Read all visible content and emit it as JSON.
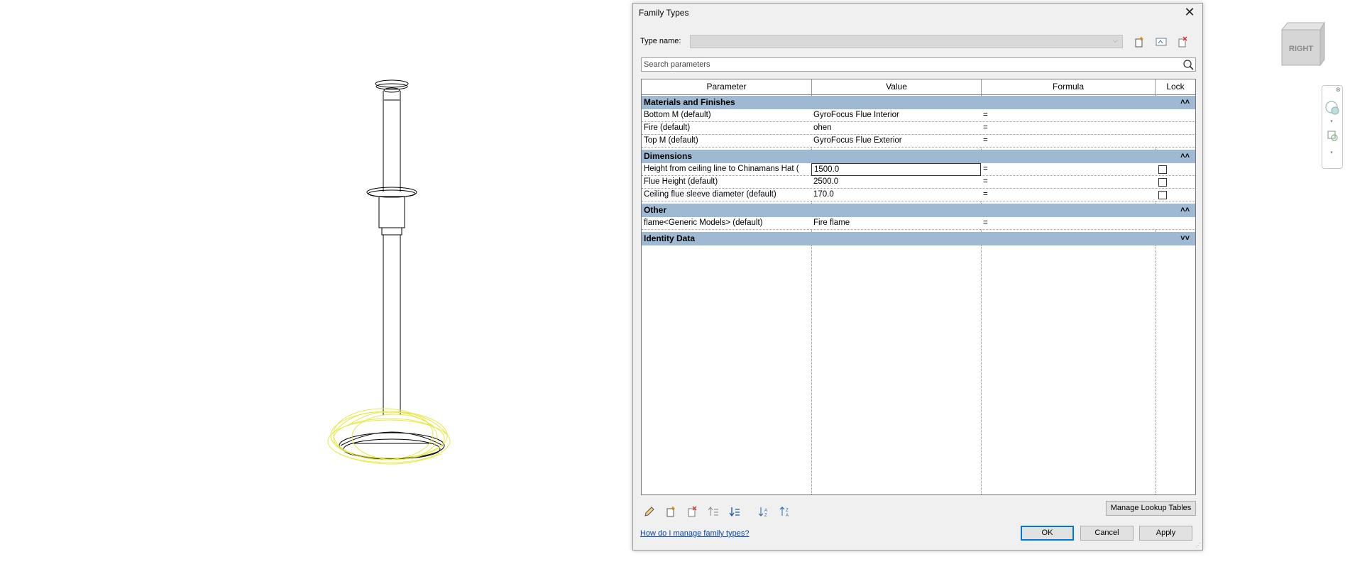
{
  "viewcube": {
    "face_label": "RIGHT"
  },
  "dialog": {
    "title": "Family Types",
    "close_glyph": "✕",
    "type_name_label": "Type name:",
    "type_name_value": "",
    "search_placeholder": "Search parameters",
    "columns": [
      "Parameter",
      "Value",
      "Formula",
      "Lock"
    ],
    "groups": [
      {
        "name": "Materials and Finishes",
        "toggle": "˄˄",
        "rows": [
          {
            "parameter": "Bottom M (default)",
            "value": "GyroFocus Flue Interior",
            "formula": "=",
            "lock": null
          },
          {
            "parameter": "Fire (default)",
            "value": "ohen",
            "formula": "=",
            "lock": null
          },
          {
            "parameter": "Top M (default)",
            "value": "GyroFocus Flue Exterior",
            "formula": "=",
            "lock": null
          }
        ]
      },
      {
        "name": "Dimensions",
        "toggle": "˄˄",
        "rows": [
          {
            "parameter": "Height from ceiling line to Chinamans Hat (",
            "value": "1500.0",
            "formula": "=",
            "lock": false
          },
          {
            "parameter": "Flue Height (default)",
            "value": "2500.0",
            "formula": "=",
            "lock": false
          },
          {
            "parameter": "Ceiling flue sleeve diameter (default)",
            "value": "170.0",
            "formula": "=",
            "lock": false
          }
        ]
      },
      {
        "name": "Other",
        "toggle": "˄˄",
        "rows": [
          {
            "parameter": "flame<Generic Models> (default)",
            "value": "Fire flame",
            "formula": "=",
            "lock": null
          }
        ]
      },
      {
        "name": "Identity Data",
        "toggle": "˅˅",
        "rows": []
      }
    ],
    "manage_lookup_label": "Manage Lookup Tables",
    "help_link": "How do I manage family types?",
    "ok_label": "OK",
    "cancel_label": "Cancel",
    "apply_label": "Apply"
  },
  "colors": {
    "group_header": "#9fb9d3",
    "flame": "#e8e84a",
    "link": "#0645ad",
    "default_button_border": "#0078d7"
  }
}
